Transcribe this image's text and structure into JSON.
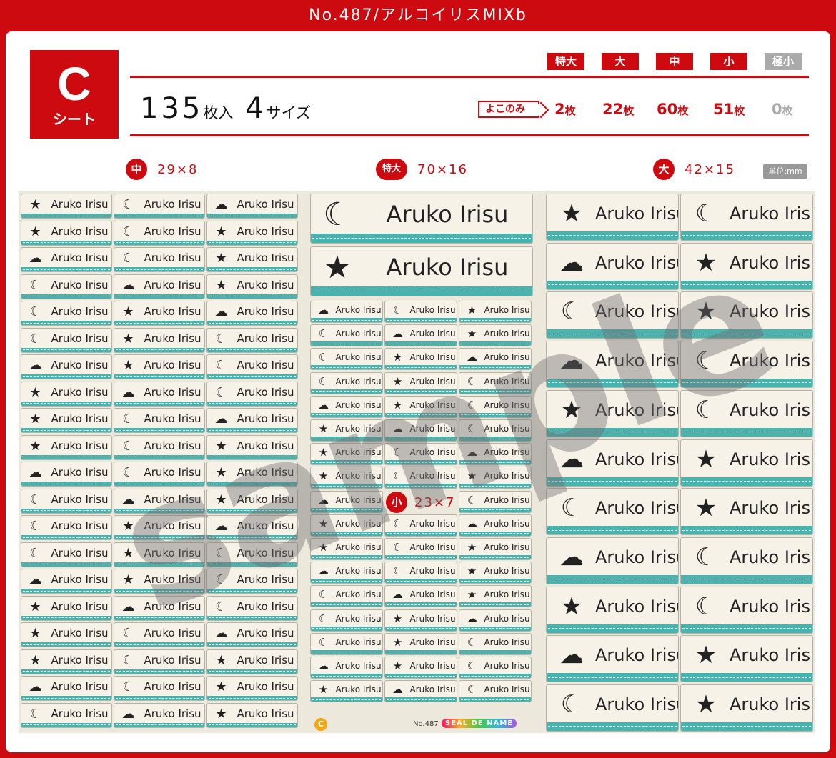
{
  "header": {
    "title": "No.487/アルコイリスMIXb"
  },
  "sheet_badge": {
    "letter": "C",
    "label": "シート"
  },
  "summary": {
    "count": "135",
    "count_unit": "枚入",
    "sizes": "4",
    "sizes_unit": "サイズ"
  },
  "size_labels": [
    "特大",
    "大",
    "中",
    "小",
    "極小"
  ],
  "yoko": "よこのみ",
  "quantities": [
    {
      "num": "2",
      "unit": "枚"
    },
    {
      "num": "22",
      "unit": "枚"
    },
    {
      "num": "60",
      "unit": "枚"
    },
    {
      "num": "51",
      "unit": "枚"
    },
    {
      "num": "0",
      "unit": "枚"
    }
  ],
  "sections": {
    "medium": {
      "badge": "中",
      "dims": "29×8"
    },
    "xlarge": {
      "badge": "特大",
      "dims": "70×16"
    },
    "large": {
      "badge": "大",
      "dims": "42×15"
    },
    "small": {
      "badge": "小",
      "dims": "23×7"
    }
  },
  "unit_note": "単位:mm",
  "name": "Aruko Irisu",
  "watermark": "sample",
  "footer": {
    "sheet_mark": "C",
    "code": "No.487",
    "logo": "SEAL DE NAME"
  },
  "icons": [
    "star-icon",
    "moon-icon",
    "cloud-icon",
    "star-icon",
    "moon-icon",
    "star-icon",
    "cloud-icon",
    "moon-icon"
  ],
  "colors": {
    "brand": "#cc0a10",
    "band": "#48b4b0",
    "disabled": "#aaaaaa"
  }
}
